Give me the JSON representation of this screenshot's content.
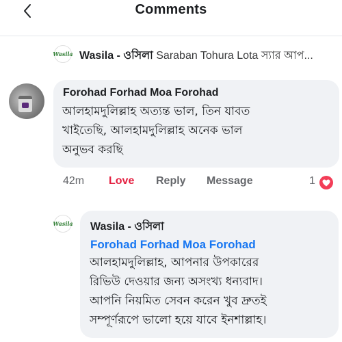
{
  "header": {
    "title": "Comments"
  },
  "post": {
    "page_name": "Wasila - ওসিলা",
    "preview_text": " Saraban Tohura Lota স্যার আপ..."
  },
  "logo_text": "Wasila",
  "comment": {
    "author": "Forohad Forhad Moa Forohad",
    "lines": [
      "আলহামদুলিল্লাহ অত্যন্ত ভাল, তিন যাবত",
      "খাইতেছি, আলহামদুলিল্লাহ অনেক ভাল",
      "অনুভব করছি"
    ],
    "time": "42m",
    "love_label": "Love",
    "reply_label": "Reply",
    "message_label": "Message",
    "reaction_count": "1"
  },
  "reply": {
    "author": "Wasila - ওসিলা",
    "mention": "Forohad Forhad Moa Forohad",
    "lines": [
      "আলহামদুলিল্লাহ, আপনার উপকারের",
      "রিভিউ দেওয়ার জন্য অসংখ্য ধন্যবাদ।",
      "আপনি নিয়মিত সেবন করেন খুব দ্রুতই",
      "সম্পূর্ণরূপে ভালো হয়ে যাবে ইনশাল্লাহ।"
    ]
  },
  "colors": {
    "link_blue": "#1877f2",
    "love_red": "#e41e3f",
    "bubble_bg": "#f0f2f5",
    "muted_text": "#65676b"
  },
  "icons": {
    "back": "chevron-left-icon",
    "reaction": "heart-icon"
  }
}
